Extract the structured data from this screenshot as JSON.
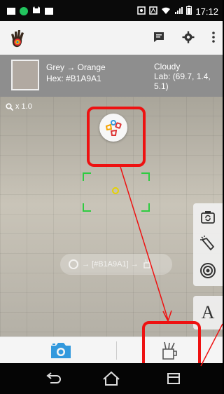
{
  "status_bar": {
    "time": "17:12"
  },
  "app_bar": {
    "logo_icon": "hand-palette-logo",
    "actions": [
      {
        "icon": "chat-icon"
      },
      {
        "icon": "gear-icon"
      },
      {
        "icon": "more-vertical-icon"
      }
    ]
  },
  "color_info": {
    "swatch_color": "#B1A9A1",
    "name": "Grey → Orange",
    "hex": "Hex: #B1A9A1",
    "description": "Cloudy",
    "lab": "Lab: (69.7, 1.4, 5.1)"
  },
  "camera": {
    "zoom_label": "x 1.0",
    "hint_text": "→ [#B1A9A1] →"
  },
  "side_tools": {
    "letter": "A"
  },
  "colors": {
    "highlight": "#E11111",
    "accent_blue": "#3399DD",
    "reticle_green": "#2ECC40",
    "reticle_yellow": "#E6D200"
  }
}
